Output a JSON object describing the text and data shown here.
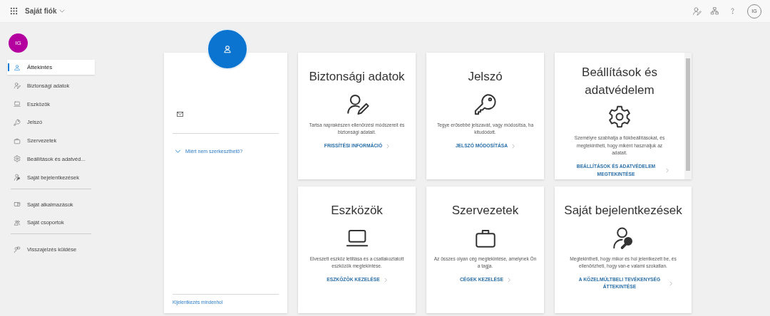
{
  "header": {
    "title": "Saját fiók",
    "user_initials": "IG"
  },
  "sidebar": {
    "avatar_initials": "IG",
    "sections": [
      {
        "items": [
          {
            "label": "Áttekintés",
            "kind": "person",
            "selected": true
          },
          {
            "label": "Biztonsági adatok",
            "kind": "person-edit",
            "selected": false
          },
          {
            "label": "Eszközök",
            "kind": "laptop",
            "selected": false
          },
          {
            "label": "Jelszó",
            "kind": "key",
            "selected": false
          },
          {
            "label": "Szervezetek",
            "kind": "briefcase",
            "selected": false
          },
          {
            "label": "Beállítások és adatvéd...",
            "kind": "gear",
            "selected": false
          },
          {
            "label": "Saját bejelentkezések",
            "kind": "person-key",
            "selected": false
          }
        ]
      },
      {
        "items": [
          {
            "label": "Saját alkalmazások",
            "kind": "apps",
            "selected": false
          },
          {
            "label": "Saját csoportok",
            "kind": "group",
            "selected": false
          }
        ]
      },
      {
        "items": [
          {
            "label": "Visszajelzés küldése",
            "kind": "feedback",
            "selected": false
          }
        ]
      }
    ]
  },
  "profile": {
    "why_link": "Miért nem szerkeszthető?",
    "sign_out_link": "Kijelentkezés mindenhol"
  },
  "cards": [
    {
      "title": "Biztonsági adatok",
      "kind": "person-edit",
      "description": "Tartsa naprakészen ellenőrzési módszereit és biztonsági adatait.",
      "link": "FRISSÍTÉSI INFORMÁCIÓ"
    },
    {
      "title": "Jelszó",
      "kind": "key",
      "description": "Tegye erősebbé jelszavát, vagy módosítsa, ha kitudódott.",
      "link": "JELSZÓ MÓDOSÍTÁSA"
    },
    {
      "title": "Beállítások és adatvédelem",
      "kind": "gear",
      "description": "Személyre szabhatja a fiókbeállításokat, és megtekintheti, hogy miként használjuk az adatait.",
      "link": "BEÁLLÍTÁSOK ÉS ADATVÉDELEM MEGTEKINTÉSE",
      "scrollable": true
    },
    {
      "title": "Eszközök",
      "kind": "laptop",
      "description": "Elveszett eszköz letiltása és a csatlakoztatott eszközök megtekintése.",
      "link": "ESZKÖZÖK KEZELÉSE"
    },
    {
      "title": "Szervezetek",
      "kind": "briefcase",
      "description": "Az összes olyan cég megtekintése, amelynek Ön a tagja.",
      "link": "CÉGEK KEZELÉSE"
    },
    {
      "title": "Saját bejelentkezések",
      "kind": "person-key",
      "description": "Megtekintheti, hogy mikor és hol jelentkezett be, és ellenőrizheti, hogy van-e valami szokatlan.",
      "link": "A KÖZELMÚLTBELI TEVÉKENYSÉG ÁTTEKINTÉSE"
    }
  ]
}
